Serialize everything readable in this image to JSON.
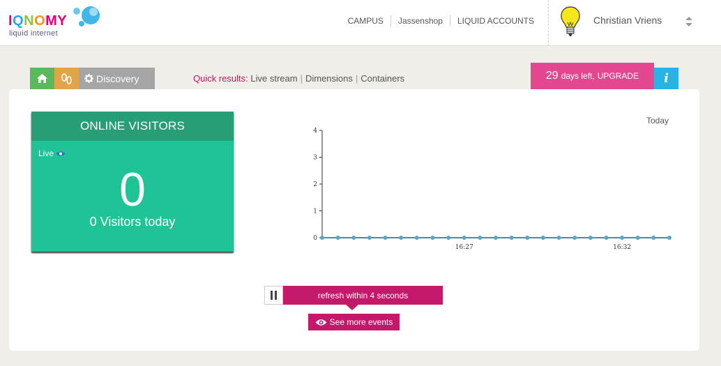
{
  "brand": {
    "logo_text": [
      "I",
      "Q",
      "N",
      "O",
      "MY"
    ],
    "tagline": "liquid internet"
  },
  "nav": {
    "items": [
      "CAMPUS",
      "Jassenshop",
      "LIQUID ACCOUNTS"
    ]
  },
  "user": {
    "name": "Christian Vriens"
  },
  "toolbar": {
    "discovery_label": "Discovery"
  },
  "quick_results": {
    "label": "Quick results:",
    "links": [
      "Live stream",
      "Dimensions",
      "Containers"
    ]
  },
  "upgrade": {
    "days": "29",
    "days_suffix": "days left,",
    "action": "UPGRADE"
  },
  "info": {
    "label": "i"
  },
  "visitors_card": {
    "title": "ONLINE VISITORS",
    "live_label": "Live",
    "count": "0",
    "today_text": "0 Visitors today"
  },
  "chart_data": {
    "type": "line",
    "title": "",
    "period_label": "Today",
    "xlabel": "",
    "ylabel": "",
    "ylim": [
      0,
      4
    ],
    "y_ticks": [
      "0",
      "1",
      "2",
      "3",
      "4"
    ],
    "x_tick_labels": [
      {
        "index": 9,
        "label": "16:27"
      },
      {
        "index": 19,
        "label": "16:32"
      }
    ],
    "series": [
      {
        "values": [
          0,
          0,
          0,
          0,
          0,
          0,
          0,
          0,
          0,
          0,
          0,
          0,
          0,
          0,
          0,
          0,
          0,
          0,
          0,
          0,
          0,
          0,
          0
        ]
      }
    ],
    "grid": false
  },
  "controls": {
    "refresh_text": "refresh within 4 seconds",
    "see_more": "See more events"
  },
  "colors": {
    "accent": "#c4186a",
    "card_green": "#1ec495",
    "card_head": "#279e75",
    "upgrade_pink": "#e2478f",
    "info_blue": "#27b4e4",
    "line": "#2c5f74",
    "point": "#5aa6c4"
  }
}
